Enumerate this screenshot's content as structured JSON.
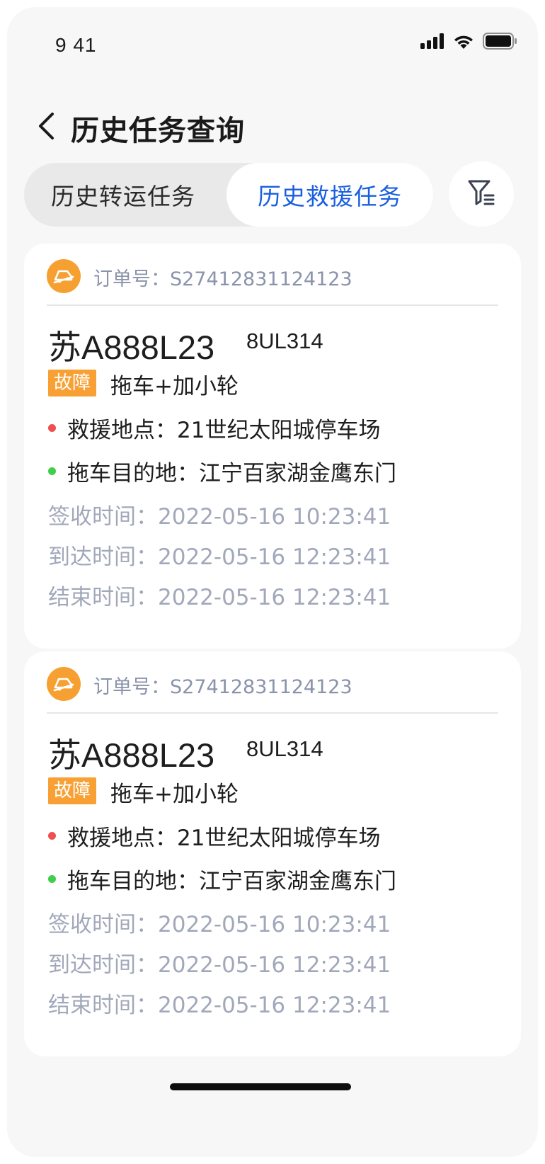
{
  "status_bar": {
    "time": "9 41",
    "icons": [
      "signal-icon",
      "wifi-icon",
      "battery-icon"
    ]
  },
  "nav": {
    "back_icon": "chevron-left-icon",
    "title": "历史任务查询"
  },
  "tabs": {
    "items": [
      {
        "label": "历史转运任务",
        "active": false
      },
      {
        "label": "历史救援任务",
        "active": true
      }
    ],
    "filter_icon": "filter-list-icon"
  },
  "colors": {
    "accent_blue": "#1a5fe0",
    "badge_orange": "#f8a033",
    "dot_red": "#f04f4f",
    "dot_green": "#3fcf4a",
    "muted_text": "#a1a8ba"
  },
  "cards": [
    {
      "order_label": "订单号：S27412831124123",
      "plate": "苏A888L23",
      "plate_code": "8UL314",
      "badge": "故障",
      "service": "拖车+加小轮",
      "rescue_location": "救援地点：21世纪太阳城停车场",
      "tow_destination": "拖车目的地：江宁百家湖金鹰东门",
      "sign_time": "签收时间：2022-05-16 10:23:41",
      "arrive_time": "到达时间：2022-05-16 12:23:41",
      "end_time": "结束时间：2022-05-16 12:23:41"
    },
    {
      "order_label": "订单号：S27412831124123",
      "plate": "苏A888L23",
      "plate_code": "8UL314",
      "badge": "故障",
      "service": "拖车+加小轮",
      "rescue_location": "救援地点：21世纪太阳城停车场",
      "tow_destination": "拖车目的地：江宁百家湖金鹰东门",
      "sign_time": "签收时间：2022-05-16 10:23:41",
      "arrive_time": "到达时间：2022-05-16 12:23:41",
      "end_time": "结束时间：2022-05-16 12:23:41"
    }
  ]
}
